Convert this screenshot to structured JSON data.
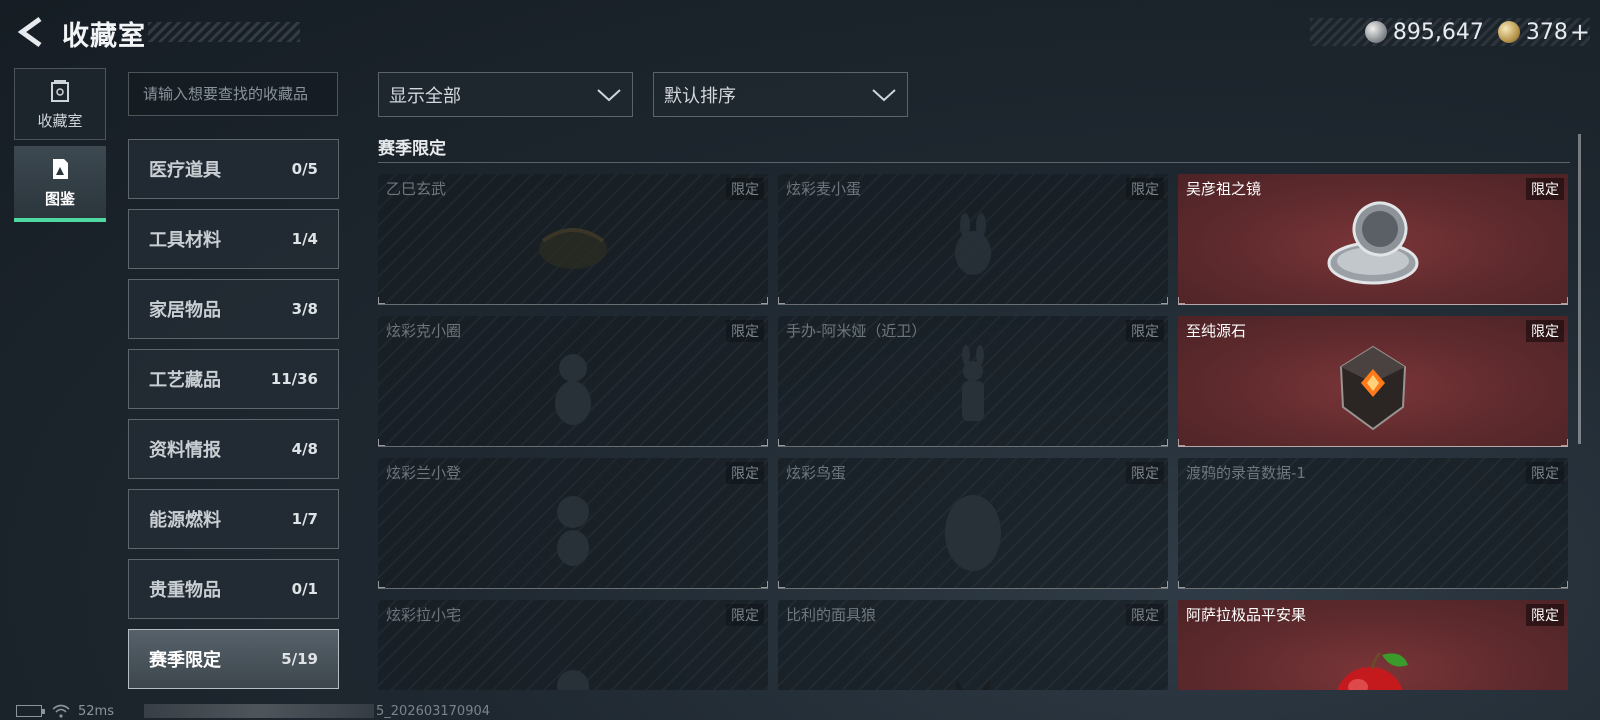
{
  "header": {
    "title": "收藏室",
    "currency": [
      {
        "name": "silver-coin",
        "value": "895,647"
      },
      {
        "name": "gold-coin",
        "value": "378"
      }
    ],
    "plus_label": "+"
  },
  "nav": {
    "items": [
      {
        "label": "收藏室",
        "icon": "vault-icon",
        "active": false
      },
      {
        "label": "图鉴",
        "icon": "codex-icon",
        "active": true
      }
    ]
  },
  "search": {
    "placeholder": "请输入想要查找的收藏品",
    "value": ""
  },
  "categories": [
    {
      "label": "医疗道具",
      "count": "0/5"
    },
    {
      "label": "工具材料",
      "count": "1/4"
    },
    {
      "label": "家居物品",
      "count": "3/8"
    },
    {
      "label": "工艺藏品",
      "count": "11/36"
    },
    {
      "label": "资料情报",
      "count": "4/8"
    },
    {
      "label": "能源燃料",
      "count": "1/7"
    },
    {
      "label": "贵重物品",
      "count": "0/1"
    },
    {
      "label": "赛季限定",
      "count": "5/19",
      "active": true
    }
  ],
  "filters": {
    "display": "显示全部",
    "sort": "默认排序"
  },
  "section": {
    "title": "赛季限定"
  },
  "items": [
    {
      "name": "乙巳玄武",
      "tag": "限定",
      "owned": false
    },
    {
      "name": "炫彩麦小蛋",
      "tag": "限定",
      "owned": false
    },
    {
      "name": "吴彦祖之镜",
      "tag": "限定",
      "owned": true
    },
    {
      "name": "炫彩克小圈",
      "tag": "限定",
      "owned": false
    },
    {
      "name": "手办-阿米娅（近卫）",
      "tag": "限定",
      "owned": false
    },
    {
      "name": "至纯源石",
      "tag": "限定",
      "owned": true
    },
    {
      "name": "炫彩兰小登",
      "tag": "限定",
      "owned": false
    },
    {
      "name": "炫彩鸟蛋",
      "tag": "限定",
      "owned": false
    },
    {
      "name": "渡鸦的录音数据-1",
      "tag": "限定",
      "owned": false
    },
    {
      "name": "炫彩拉小宅",
      "tag": "限定",
      "owned": false
    },
    {
      "name": "比利的面具狼",
      "tag": "限定",
      "owned": false
    },
    {
      "name": "阿萨拉极品平安果",
      "tag": "限定",
      "owned": true
    }
  ],
  "status": {
    "ping": "52ms",
    "build": "5_202603170904"
  },
  "colors": {
    "accent": "#4fd8a0",
    "owned_card": "#5e2a2d",
    "locked_card": "#1a2229"
  }
}
